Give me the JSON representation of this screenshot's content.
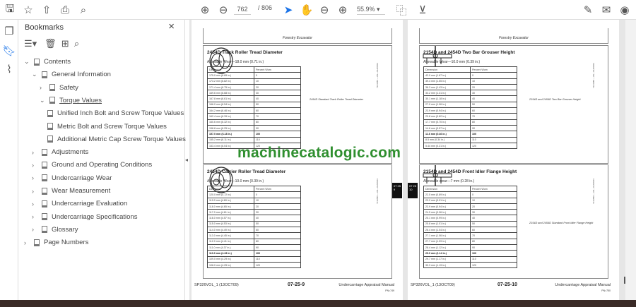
{
  "toolbar": {
    "current_page": "762",
    "total_pages": "/ 806",
    "zoom": "55.9%"
  },
  "bookmarks": {
    "title": "Bookmarks",
    "items": [
      {
        "label": "Contents",
        "level": 0,
        "chev": "⌄"
      },
      {
        "label": "General Information",
        "level": 1,
        "chev": "⌄"
      },
      {
        "label": "Safety",
        "level": 2,
        "chev": "›"
      },
      {
        "label": "Torque Values",
        "level": 2,
        "chev": "⌄",
        "underline": true
      },
      {
        "label": "Unified Inch Bolt and Screw Torque Values",
        "level": 3,
        "leaf": true
      },
      {
        "label": "Metric Bolt and Screw Torque Values",
        "level": 3,
        "leaf": true
      },
      {
        "label": "Additional Metric Cap Screw Torque Values",
        "level": 3,
        "leaf": true
      },
      {
        "label": "Adjustments",
        "level": 1,
        "chev": "›"
      },
      {
        "label": "Ground and Operating Conditions",
        "level": 1,
        "chev": "›"
      },
      {
        "label": "Undercarriage Wear",
        "level": 1,
        "chev": "›"
      },
      {
        "label": "Wear Measurement",
        "level": 1,
        "chev": "›"
      },
      {
        "label": "Undercarriage Evaluation",
        "level": 1,
        "chev": "›"
      },
      {
        "label": "Undercarriage Specifications",
        "level": 1,
        "chev": "›"
      },
      {
        "label": "Glossary",
        "level": 1,
        "chev": "›"
      },
      {
        "label": "Page Numbers",
        "level": 0,
        "chev": "›"
      }
    ]
  },
  "watermark": "machinecatalogic.com",
  "pages": [
    {
      "header": "Forestry Excavator",
      "footer_left": "SP326VOL_1 (13OCT09)",
      "page_number": "07-25-9",
      "footer_right": "Undercarriage Appraisal Manual",
      "footer_sub": "PN=749",
      "tab": "07 25 9",
      "sections": [
        {
          "title": "2454D Track Roller Tread Diameter",
          "allowable": "Allowable Wear—18.0 mm (0.71 in.)",
          "headers": [
            "Dimension",
            "Percent Worn"
          ],
          "caption": "2454D Standard Track Roller Tread Diameter",
          "ref": "T191586 —UN—01APR03",
          "rows": [
            [
              "175.0 mm (6.89 in.)",
              "0"
            ],
            [
              "173.2 mm (6.82 in.)",
              "10"
            ],
            [
              "171.4 mm (6.75 in.)",
              "20"
            ],
            [
              "169.6 mm (6.68 in.)",
              "30"
            ],
            [
              "167.8 mm (6.61 in.)",
              "40"
            ],
            [
              "166.0 mm (6.54 in.)",
              "50"
            ],
            [
              "164.2 mm (6.46 in.)",
              "60"
            ],
            [
              "162.4 mm (6.39 in.)",
              "70"
            ],
            [
              "160.6 mm (6.32 in.)",
              "80"
            ],
            [
              "158.8 mm (6.25 in.)",
              "90"
            ],
            [
              "157.0 mm (6.18 in.)",
              "100"
            ],
            [
              "155.2 mm (6.11 in.)",
              "110"
            ],
            [
              "153.4 mm (6.04 in.)",
              "120"
            ]
          ]
        },
        {
          "title": "2454D Carrier Roller Tread Diameter",
          "allowable": "Allowable Wear—10.0 mm (0.39 in.)",
          "headers": [
            "Dimension",
            "Percent Worn"
          ],
          "caption": "",
          "ref": "T191586 —UN—01APR03",
          "rows": [
            [
              "120.0 mm (4.72 in.)",
              "0"
            ],
            [
              "119.0 mm (4.69 in.)",
              "10"
            ],
            [
              "118.0 mm (4.65 in.)",
              "20"
            ],
            [
              "117.0 mm (4.61 in.)",
              "30"
            ],
            [
              "116.0 mm (4.57 in.)",
              "40"
            ],
            [
              "115.0 mm (4.53 in.)",
              "50"
            ],
            [
              "114.0 mm (4.49 in.)",
              "60"
            ],
            [
              "113.0 mm (4.45 in.)",
              "70"
            ],
            [
              "112.0 mm (4.41 in.)",
              "80"
            ],
            [
              "111.0 mm (4.37 in.)",
              "90"
            ],
            [
              "110.0 mm (4.33 in.)",
              "100"
            ],
            [
              "109.0 mm (4.29 in.)",
              "110"
            ],
            [
              "108.0 mm (4.25 in.)",
              "120"
            ]
          ]
        }
      ]
    },
    {
      "header": "Forestry Excavator",
      "footer_left": "SP326VOL_1 (13OCT09)",
      "page_number": "07-25-10",
      "footer_right": "Undercarriage Appraisal Manual",
      "footer_sub": "PN=750",
      "tab": "07 25 10",
      "sections": [
        {
          "title": "2154D and 2454D Two Bar Grouser Height",
          "allowable": "Allowable Wear—10.0 mm (0.39 in.)",
          "headers": [
            "Dimension",
            "Percent Worn"
          ],
          "caption": "2154D and 2454D Two Bar Grouser Height",
          "ref": "T191588 —UN—01APR03",
          "rows": [
            [
              "42.0 mm (1.67 in.)",
              "0"
            ],
            [
              "39.4 mm (1.55 in.)",
              "10"
            ],
            [
              "36.3 mm (1.43 in.)",
              "20"
            ],
            [
              "33.2 mm (1.31 in.)",
              "30"
            ],
            [
              "30.1 mm (1.18 in.)",
              "40"
            ],
            [
              "27.0 mm (1.06 in.)",
              "50"
            ],
            [
              "23.9 mm (0.94 in.)",
              "60"
            ],
            [
              "20.8 mm (0.82 in.)",
              "70"
            ],
            [
              "17.7 mm (0.70 in.)",
              "80"
            ],
            [
              "14.6 mm (0.57 in.)",
              "90"
            ],
            [
              "11.6 mm (0.46 in.)",
              "100"
            ],
            [
              "8.5 mm (0.34 in.)",
              "110"
            ],
            [
              "5.44 mm (0.21 in.)",
              "120"
            ]
          ]
        },
        {
          "title": "2154D and 2454D Front Idler Flange Height",
          "allowable": "Allowable wear—7 mm (0.28 in.)",
          "headers": [
            "Dimension",
            "Percent Worn"
          ],
          "caption": "2154D and 2454D Standard Front Idler Flange Height",
          "ref": "T191589 —UN—01APR03",
          "rows": [
            [
              "22.5 mm (0.89 in.)",
              "0"
            ],
            [
              "23.2 mm (0.91 in.)",
              "10"
            ],
            [
              "23.9 mm (0.94 in.)",
              "20"
            ],
            [
              "24.5 mm (0.96 in.)",
              "30"
            ],
            [
              "25.1 mm (0.99 in.)",
              "40"
            ],
            [
              "25.8 mm (1.01 in.)",
              "50"
            ],
            [
              "26.4 mm (1.04 in.)",
              "60"
            ],
            [
              "27.1 mm (1.06 in.)",
              "70"
            ],
            [
              "27.7 mm (1.09 in.)",
              "80"
            ],
            [
              "28.4 mm (1.12 in.)",
              "90"
            ],
            [
              "29.0 mm (1.14 in.)",
              "100"
            ],
            [
              "29.7 mm (1.17 in.)",
              "110"
            ],
            [
              "30.3 mm (1.19 in.)",
              "120"
            ]
          ]
        }
      ]
    }
  ]
}
